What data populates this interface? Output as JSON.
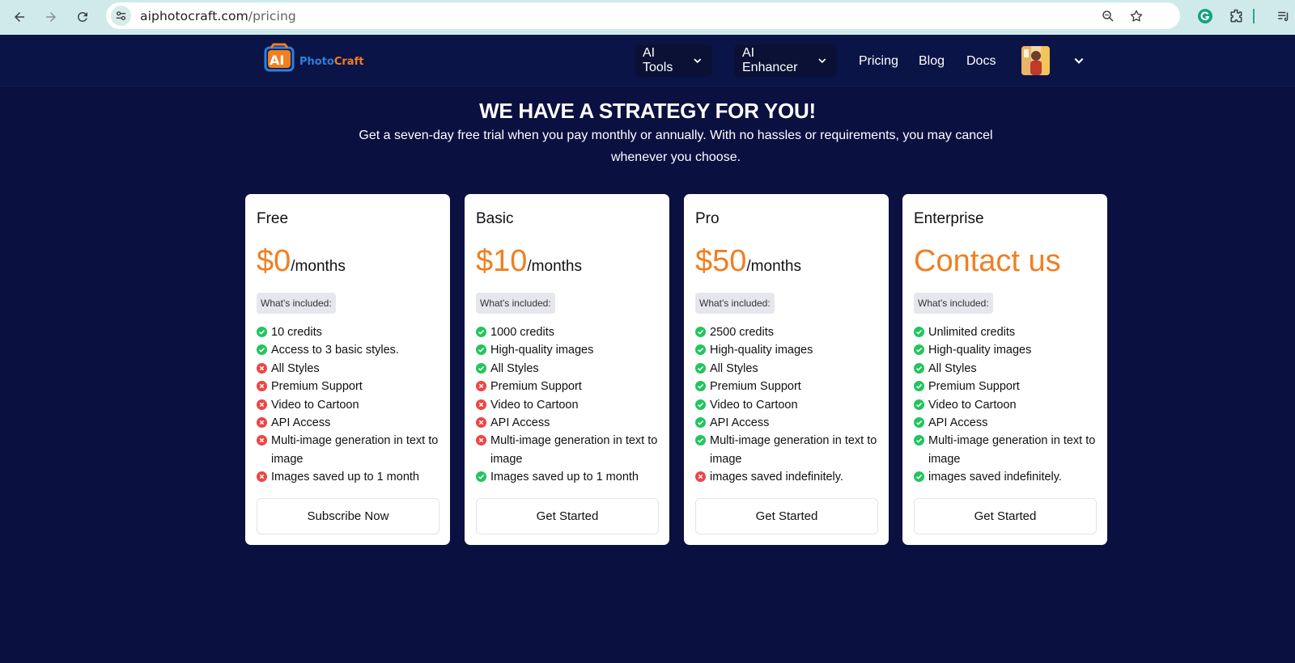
{
  "browser": {
    "url_domain": "aiphotocraft.com",
    "url_path": "/pricing"
  },
  "header": {
    "logo": {
      "ai": "AI",
      "photo": "Photo",
      "craft": "Craft"
    },
    "nav": {
      "ai_tools": "AI Tools",
      "ai_enhancer": "AI Enhancer",
      "pricing": "Pricing",
      "blog": "Blog",
      "docs": "Docs"
    }
  },
  "hero": {
    "title": "WE HAVE A STRATEGY FOR YOU!",
    "subtitle": "Get a seven-day free trial when you pay monthly or annually. With no hassles or requirements, you may cancel whenever you choose."
  },
  "colors": {
    "page_bg": "#0a1040",
    "header_bg": "#0b1447",
    "price_accent": "#f07f22",
    "check_green": "#22c55e",
    "cross_red": "#ef4444"
  },
  "plans": [
    {
      "name": "Free",
      "price": "$0",
      "period": "/months",
      "included_label": "What's included:",
      "features": [
        {
          "text": "10 credits",
          "included": true
        },
        {
          "text": "Access to 3 basic styles.",
          "included": true
        },
        {
          "text": "All Styles",
          "included": false
        },
        {
          "text": "Premium Support",
          "included": false
        },
        {
          "text": "Video to Cartoon",
          "included": false
        },
        {
          "text": "API Access",
          "included": false
        },
        {
          "text": "Multi-image generation in text to image",
          "included": false
        },
        {
          "text": "Images saved up to 1 month",
          "included": false
        }
      ],
      "cta": "Subscribe Now"
    },
    {
      "name": "Basic",
      "price": "$10",
      "period": "/months",
      "included_label": "What's included:",
      "features": [
        {
          "text": "1000 credits",
          "included": true
        },
        {
          "text": "High-quality images",
          "included": true
        },
        {
          "text": "All Styles",
          "included": true
        },
        {
          "text": "Premium Support",
          "included": false
        },
        {
          "text": "Video to Cartoon",
          "included": false
        },
        {
          "text": "API Access",
          "included": false
        },
        {
          "text": "Multi-image generation in text to image",
          "included": false
        },
        {
          "text": "Images saved up to 1 month",
          "included": true
        }
      ],
      "cta": "Get Started"
    },
    {
      "name": "Pro",
      "price": "$50",
      "period": "/months",
      "included_label": "What's included:",
      "features": [
        {
          "text": "2500 credits",
          "included": true
        },
        {
          "text": "High-quality images",
          "included": true
        },
        {
          "text": "All Styles",
          "included": true
        },
        {
          "text": "Premium Support",
          "included": true
        },
        {
          "text": "Video to Cartoon",
          "included": true
        },
        {
          "text": "API Access",
          "included": true
        },
        {
          "text": "Multi-image generation in text to image",
          "included": true
        },
        {
          "text": "images saved indefinitely.",
          "included": false
        }
      ],
      "cta": "Get Started"
    },
    {
      "name": "Enterprise",
      "price": "Contact us",
      "period": "",
      "included_label": "What's included:",
      "features": [
        {
          "text": "Unlimited credits",
          "included": true
        },
        {
          "text": "High-quality images",
          "included": true
        },
        {
          "text": "All Styles",
          "included": true
        },
        {
          "text": "Premium Support",
          "included": true
        },
        {
          "text": "Video to Cartoon",
          "included": true
        },
        {
          "text": "API Access",
          "included": true
        },
        {
          "text": "Multi-image generation in text to image",
          "included": true
        },
        {
          "text": "images saved indefinitely.",
          "included": true
        }
      ],
      "cta": "Get Started"
    }
  ]
}
